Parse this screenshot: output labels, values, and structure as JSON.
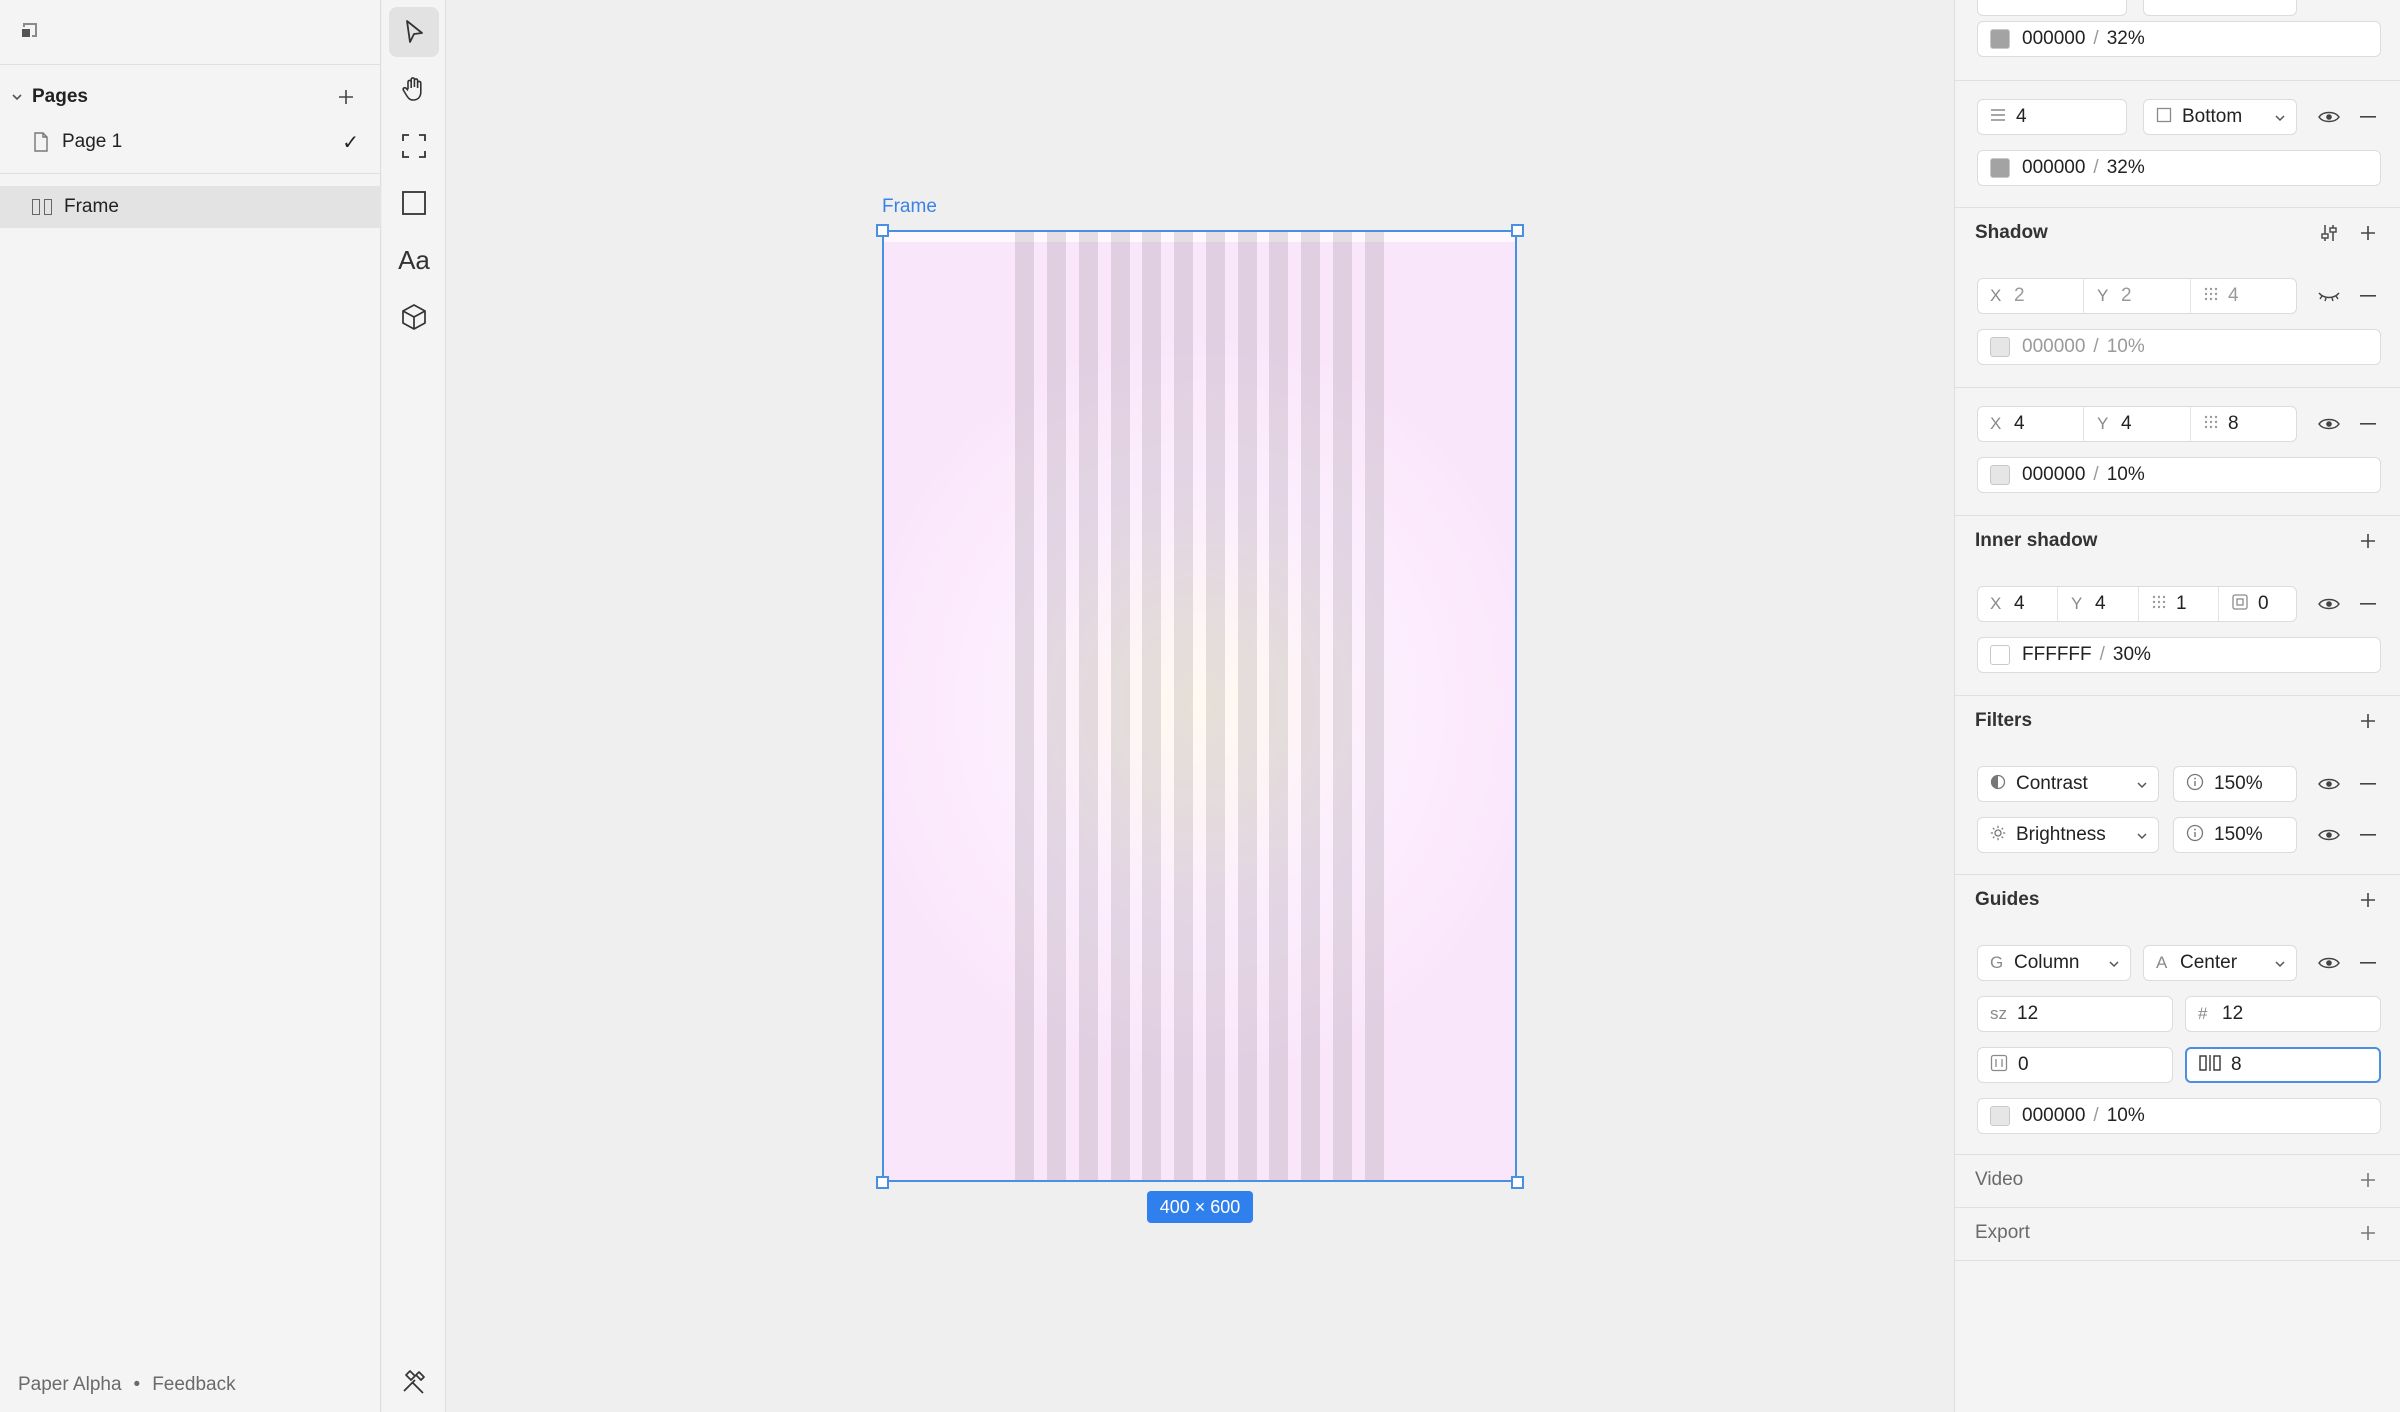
{
  "left_panel": {
    "pages_title": "Pages",
    "pages": [
      {
        "label": "Page 1",
        "selected": true
      }
    ],
    "layers": [
      {
        "label": "Frame"
      }
    ],
    "footer": {
      "app_name": "Paper Alpha",
      "separator": "•",
      "feedback": "Feedback"
    }
  },
  "canvas": {
    "frame_label": "Frame",
    "size_badge": "400 × 600",
    "frame_background": "#fdeefe",
    "selection_color": "#4a90e2"
  },
  "right_panel": {
    "border_top": {
      "color_value": "000000",
      "separator": "/",
      "opacity": "32%"
    },
    "border": {
      "width": "4",
      "side": "Bottom",
      "color_value": "000000",
      "separator": "/",
      "opacity": "32%"
    },
    "shadow": {
      "title": "Shadow",
      "items": [
        {
          "x_label": "X",
          "x": "2",
          "y_label": "Y",
          "y": "2",
          "blur": "4",
          "color_value": "000000",
          "separator": "/",
          "opacity": "10%",
          "visible": false
        },
        {
          "x_label": "X",
          "x": "4",
          "y_label": "Y",
          "y": "4",
          "blur": "8",
          "color_value": "000000",
          "separator": "/",
          "opacity": "10%",
          "visible": true
        }
      ]
    },
    "inner_shadow": {
      "title": "Inner shadow",
      "x_label": "X",
      "x": "4",
      "y_label": "Y",
      "y": "4",
      "blur": "1",
      "spread": "0",
      "color_value": "FFFFFF",
      "separator": "/",
      "opacity": "30%"
    },
    "filters": {
      "title": "Filters",
      "items": [
        {
          "type": "Contrast",
          "amount": "150%"
        },
        {
          "type": "Brightness",
          "amount": "150%"
        }
      ]
    },
    "guides": {
      "title": "Guides",
      "type_prefix": "G",
      "type": "Column",
      "align_prefix": "A",
      "align": "Center",
      "size_prefix": "sz",
      "size": "12",
      "count_prefix": "#",
      "count": "12",
      "offset": "0",
      "gutter": "8",
      "color_value": "000000",
      "separator": "/",
      "opacity": "10%"
    },
    "video": {
      "title": "Video"
    },
    "export": {
      "title": "Export"
    }
  }
}
